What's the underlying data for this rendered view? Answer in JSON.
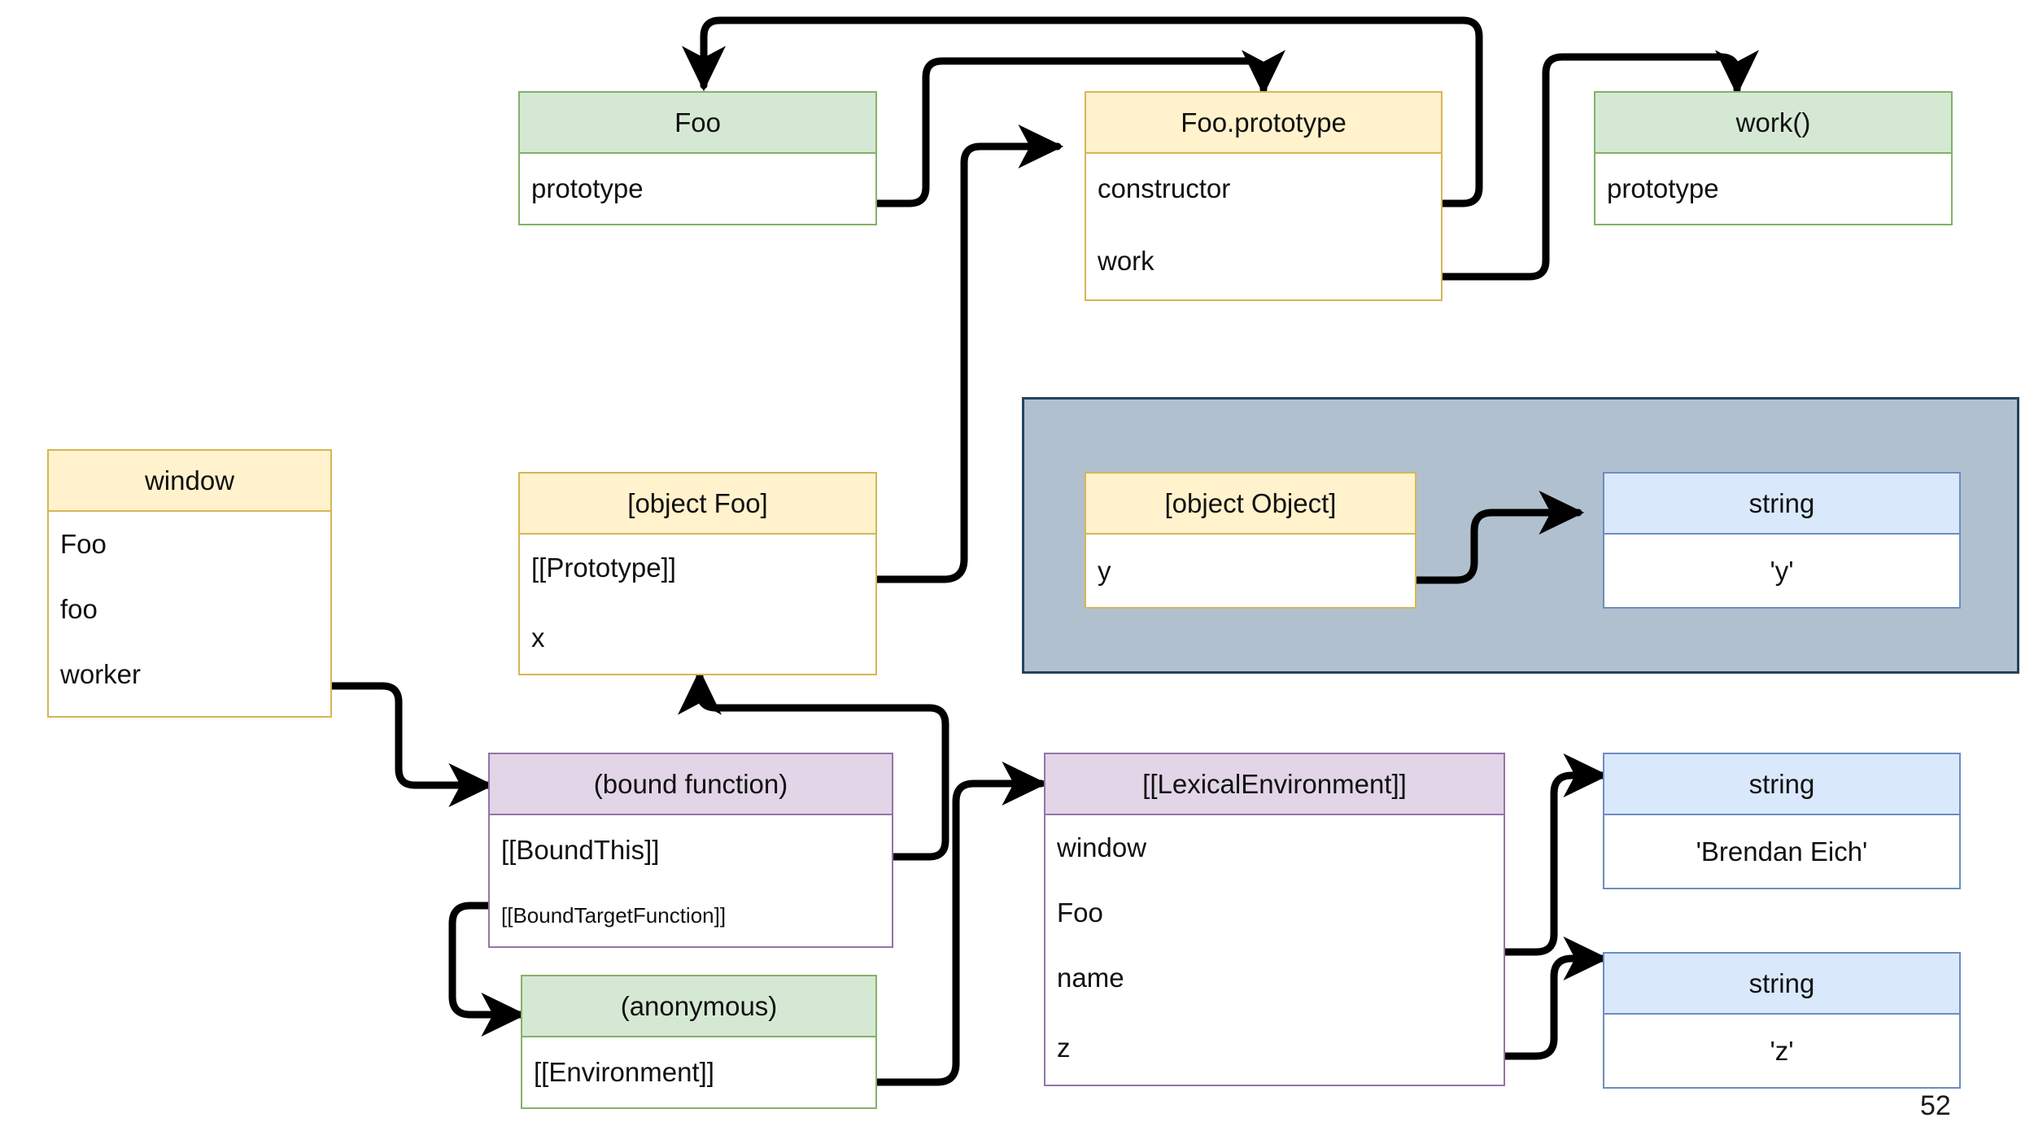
{
  "page": {
    "number": "52"
  },
  "colors": {
    "yellow_border": "#d6b656",
    "yellow_fill": "#fff2cc",
    "green_border": "#82b366",
    "green_fill": "#d5e8d4",
    "purple_border": "#9673a6",
    "purple_fill": "#e1d5e7",
    "blue_border": "#6c8ebf",
    "blue_fill": "#dae8fc",
    "gray_panel_fill": "#b1c0cf",
    "gray_panel_border": "#23445d",
    "arrow": "#000000"
  },
  "nodes": {
    "foo": {
      "title": "Foo",
      "rows": [
        "prototype"
      ]
    },
    "foo_prototype": {
      "title": "Foo.prototype",
      "rows": [
        "constructor",
        "work"
      ]
    },
    "work_fn": {
      "title": "work()",
      "rows": [
        "prototype"
      ]
    },
    "window": {
      "title": "window",
      "rows": [
        "Foo",
        "foo",
        "worker"
      ]
    },
    "object_foo": {
      "title": "[object Foo]",
      "rows": [
        "[[Prototype]]",
        "x"
      ]
    },
    "object_object": {
      "title": "[object Object]",
      "rows": [
        "y"
      ]
    },
    "string_y": {
      "title": "string",
      "rows": [
        "'y'"
      ]
    },
    "bound_function": {
      "title": "(bound function)",
      "rows": [
        "[[BoundThis]]",
        "[[BoundTargetFunction]]"
      ]
    },
    "anonymous": {
      "title": "(anonymous)",
      "rows": [
        "[[Environment]]"
      ]
    },
    "lexical_environment": {
      "title": "[[LexicalEnvironment]]",
      "rows": [
        "window",
        "Foo",
        "name",
        "z"
      ]
    },
    "string_brendan": {
      "title": "string",
      "rows": [
        "'Brendan Eich'"
      ]
    },
    "string_z": {
      "title": "string",
      "rows": [
        "'z'"
      ]
    }
  },
  "edges": [
    {
      "name": "foo-prototype-to-foo-prototype-object",
      "from": "foo.prototype",
      "to": "foo_prototype.header"
    },
    {
      "name": "foo-prototype-constructor-to-foo",
      "from": "foo_prototype.constructor",
      "to": "foo.header"
    },
    {
      "name": "foo-prototype-work-to-work-fn",
      "from": "foo_prototype.work",
      "to": "work_fn.header"
    },
    {
      "name": "window-worker-to-bound-function",
      "from": "window.worker",
      "to": "bound_function.header"
    },
    {
      "name": "object-foo-prototype-to-foo-prototype",
      "from": "object_foo.[[Prototype]]",
      "to": "foo_prototype.header"
    },
    {
      "name": "object-object-y-to-string-y",
      "from": "object_object.y",
      "to": "string_y.header"
    },
    {
      "name": "bound-this-to-object-foo",
      "from": "bound_function.[[BoundThis]]",
      "to": "object_foo.bottom"
    },
    {
      "name": "bound-target-function-to-anonymous",
      "from": "bound_function.[[BoundTargetFunction]]",
      "to": "anonymous.header"
    },
    {
      "name": "anonymous-environment-to-lexical-environment",
      "from": "anonymous.[[Environment]]",
      "to": "lexical_environment.header"
    },
    {
      "name": "lexical-name-to-string-brendan",
      "from": "lexical_environment.name",
      "to": "string_brendan.header"
    },
    {
      "name": "lexical-z-to-string-z",
      "from": "lexical_environment.z",
      "to": "string_z.header"
    }
  ]
}
